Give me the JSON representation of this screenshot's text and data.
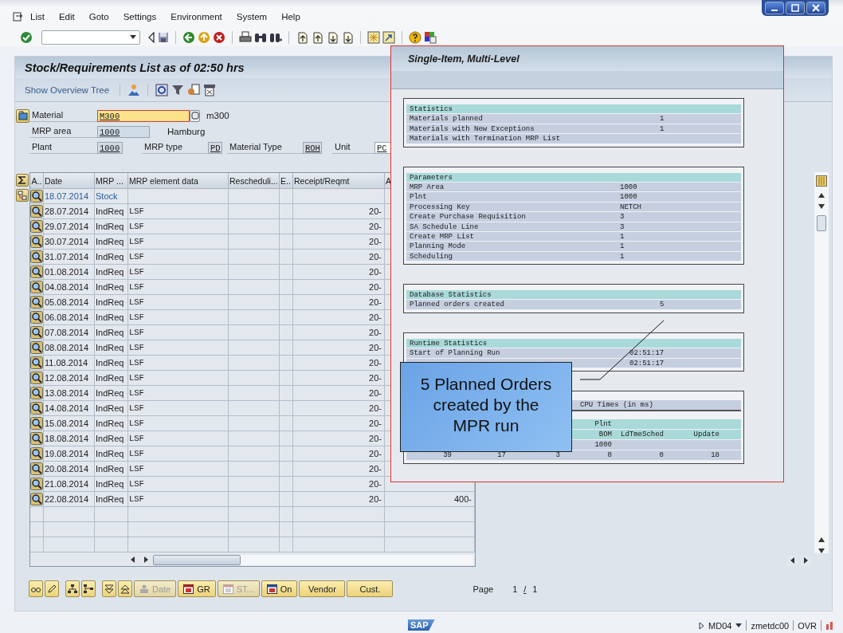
{
  "menu": [
    "List",
    "Edit",
    "Goto",
    "Settings",
    "Environment",
    "System",
    "Help"
  ],
  "title": "Stock/Requirements List as of 02:50 hrs",
  "app_toolbar": {
    "label": "Show Overview Tree"
  },
  "header": {
    "material": {
      "label": "Material",
      "value": "M300",
      "text": "m300"
    },
    "mrp_area": {
      "label": "MRP area",
      "value": "1000",
      "text": "Hamburg"
    },
    "plant": {
      "label": "Plant",
      "value": "1000"
    },
    "mrp_type": {
      "label": "MRP type",
      "value": "PD"
    },
    "material_type": {
      "label": "Material Type",
      "value": "ROH"
    },
    "unit": {
      "label": "Unit",
      "value": "PC"
    }
  },
  "table": {
    "columns": [
      "A..",
      "Date",
      "MRP ...",
      "MRP element data",
      "Rescheduli...",
      "E..",
      "Receipt/Reqmt",
      "A"
    ],
    "rows": [
      {
        "kind": "stock",
        "date": "18.07.2014",
        "mrp_element": "Stock"
      },
      {
        "kind": "req",
        "date": "28.07.2014",
        "mrp_element": "IndReq",
        "data": "LSF",
        "receipt": "20-"
      },
      {
        "kind": "req",
        "date": "29.07.2014",
        "mrp_element": "IndReq",
        "data": "LSF",
        "receipt": "20-"
      },
      {
        "kind": "req",
        "date": "30.07.2014",
        "mrp_element": "IndReq",
        "data": "LSF",
        "receipt": "20-"
      },
      {
        "kind": "req",
        "date": "31.07.2014",
        "mrp_element": "IndReq",
        "data": "LSF",
        "receipt": "20-"
      },
      {
        "kind": "req",
        "date": "01.08.2014",
        "mrp_element": "IndReq",
        "data": "LSF",
        "receipt": "20-"
      },
      {
        "kind": "req",
        "date": "04.08.2014",
        "mrp_element": "IndReq",
        "data": "LSF",
        "receipt": "20-"
      },
      {
        "kind": "req",
        "date": "05.08.2014",
        "mrp_element": "IndReq",
        "data": "LSF",
        "receipt": "20-"
      },
      {
        "kind": "req",
        "date": "06.08.2014",
        "mrp_element": "IndReq",
        "data": "LSF",
        "receipt": "20-"
      },
      {
        "kind": "req",
        "date": "07.08.2014",
        "mrp_element": "IndReq",
        "data": "LSF",
        "receipt": "20-"
      },
      {
        "kind": "req",
        "date": "08.08.2014",
        "mrp_element": "IndReq",
        "data": "LSF",
        "receipt": "20-"
      },
      {
        "kind": "req",
        "date": "11.08.2014",
        "mrp_element": "IndReq",
        "data": "LSF",
        "receipt": "20-"
      },
      {
        "kind": "req",
        "date": "12.08.2014",
        "mrp_element": "IndReq",
        "data": "LSF",
        "receipt": "20-"
      },
      {
        "kind": "req",
        "date": "13.08.2014",
        "mrp_element": "IndReq",
        "data": "LSF",
        "receipt": "20-"
      },
      {
        "kind": "req",
        "date": "14.08.2014",
        "mrp_element": "IndReq",
        "data": "LSF",
        "receipt": "20-"
      },
      {
        "kind": "req",
        "date": "15.08.2014",
        "mrp_element": "IndReq",
        "data": "LSF",
        "receipt": "20-"
      },
      {
        "kind": "req",
        "date": "18.08.2014",
        "mrp_element": "IndReq",
        "data": "LSF",
        "receipt": "20-"
      },
      {
        "kind": "req",
        "date": "19.08.2014",
        "mrp_element": "IndReq",
        "data": "LSF",
        "receipt": "20-"
      },
      {
        "kind": "req",
        "date": "20.08.2014",
        "mrp_element": "IndReq",
        "data": "LSF",
        "receipt": "20-"
      },
      {
        "kind": "req",
        "date": "21.08.2014",
        "mrp_element": "IndReq",
        "data": "LSF",
        "receipt": "20-"
      },
      {
        "kind": "req",
        "date": "22.08.2014",
        "mrp_element": "IndReq",
        "data": "LSF",
        "receipt": "20-",
        "available": "400-"
      }
    ]
  },
  "bottom_buttons": [
    {
      "label": "Date",
      "disabled": true
    },
    {
      "label": "GR",
      "disabled": false
    },
    {
      "label": "ST...",
      "disabled": true
    },
    {
      "label": "On",
      "disabled": false
    },
    {
      "label": "Vendor",
      "disabled": false
    },
    {
      "label": "Cust.",
      "disabled": false
    }
  ],
  "page": {
    "label": "Page",
    "current": "1",
    "separator": "/",
    "total": "1"
  },
  "status_bar": {
    "logo": "SAP",
    "transaction": "MD04",
    "server": "zmetdc00",
    "mode": "OVR"
  },
  "popup": {
    "title": "Single-Item, Multi-Level",
    "sections": [
      {
        "title": "Statistics",
        "rows": [
          {
            "label": "Materials planned",
            "value": "1"
          },
          {
            "label": "Materials with New Exceptions",
            "value": "1"
          },
          {
            "label": "Materials with Termination MRP List"
          }
        ]
      },
      {
        "title": "Parameters",
        "rows": [
          {
            "label": "MRP Area",
            "value": "1000"
          },
          {
            "label": "Plnt",
            "value": "1000"
          },
          {
            "label": "Processing Key",
            "value": "NETCH"
          },
          {
            "label": "Create Purchase Requisition",
            "value": "3"
          },
          {
            "label": "SA Schedule Line",
            "value": "3"
          },
          {
            "label": "Create MRP List",
            "value": "1"
          },
          {
            "label": "Planning Mode",
            "value": "1"
          },
          {
            "label": "Scheduling",
            "value": "1"
          }
        ]
      },
      {
        "title": "Database Statistics",
        "rows": [
          {
            "label": "Planned orders created",
            "value": "5"
          }
        ]
      },
      {
        "title": "Runtime Statistics",
        "rows": [
          {
            "label": "Start of Planning Run",
            "value": "02:51:17"
          },
          {
            "value": "02:51:17"
          }
        ]
      }
    ],
    "cpu": {
      "title": "CPU Times (in ms)",
      "plant_header": "Plnt",
      "headers": [
        "BOM",
        "LdTmeSched",
        "Update"
      ],
      "plant": "1000",
      "times": [
        "39",
        "17",
        "3",
        "0",
        "0",
        "18"
      ]
    }
  },
  "callout": {
    "text": "5 Planned Orders created by the MPR run"
  }
}
